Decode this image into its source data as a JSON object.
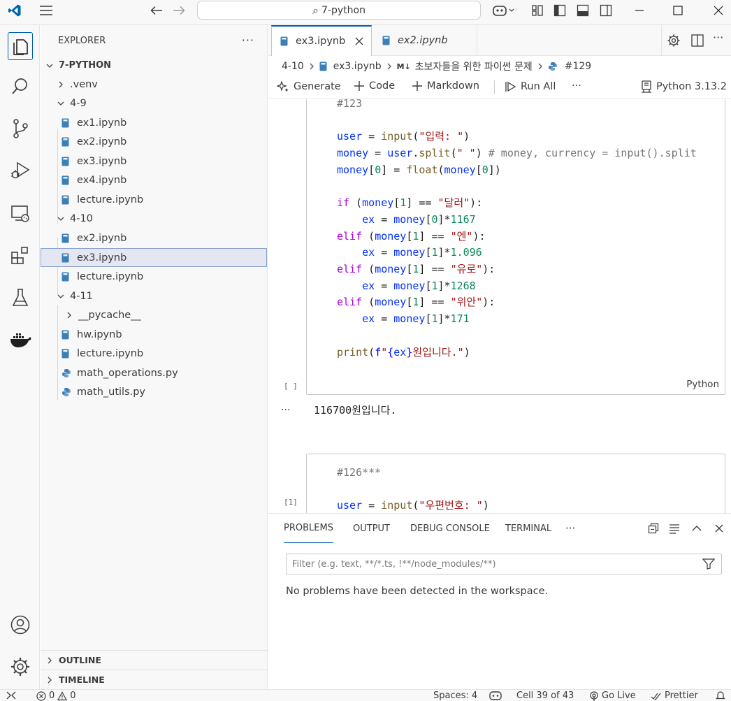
{
  "window": {
    "title": "7-python",
    "search_glyph": "⌕"
  },
  "sidebar": {
    "header": "EXPLORER",
    "more": "···",
    "root": "7-PYTHON",
    "items": [
      {
        "label": ".venv",
        "type": "folder-collapsed"
      },
      {
        "label": "4-9",
        "type": "folder-open"
      },
      {
        "label": "ex1.ipynb",
        "type": "notebook"
      },
      {
        "label": "ex2.ipynb",
        "type": "notebook"
      },
      {
        "label": "ex3.ipynb",
        "type": "notebook"
      },
      {
        "label": "ex4.ipynb",
        "type": "notebook"
      },
      {
        "label": "lecture.ipynb",
        "type": "notebook"
      },
      {
        "label": "4-10",
        "type": "folder-open"
      },
      {
        "label": "ex2.ipynb",
        "type": "notebook"
      },
      {
        "label": "ex3.ipynb",
        "type": "notebook",
        "selected": true
      },
      {
        "label": "lecture.ipynb",
        "type": "notebook"
      },
      {
        "label": "4-11",
        "type": "folder-open"
      },
      {
        "label": "__pycache__",
        "type": "folder-collapsed"
      },
      {
        "label": "hw.ipynb",
        "type": "notebook"
      },
      {
        "label": "lecture.ipynb",
        "type": "notebook"
      },
      {
        "label": "math_operations.py",
        "type": "python"
      },
      {
        "label": "math_utils.py",
        "type": "python"
      }
    ],
    "outline": "OUTLINE",
    "timeline": "TIMELINE"
  },
  "tabs": [
    {
      "label": "ex3.ipynb",
      "active": true
    },
    {
      "label": "ex2.ipynb",
      "active": false
    }
  ],
  "breadcrumbs": {
    "folder": "4-10",
    "file": "ex3.ipynb",
    "md_badge": "M↓",
    "heading": "초보자들을 위한 파이썬 문제",
    "cell": "#129"
  },
  "toolbar": {
    "generate": "Generate",
    "code": "Code",
    "markdown": "Markdown",
    "run_all": "Run All",
    "more": "···",
    "kernel": "Python 3.13.2"
  },
  "cells": {
    "cell1": {
      "exec_count": "[ ]",
      "language": "Python",
      "output_ellipsis": "···",
      "output": "116700원입니다."
    },
    "cell2": {
      "exec_count": "[1]"
    }
  },
  "panel": {
    "tabs": [
      "PROBLEMS",
      "OUTPUT",
      "DEBUG CONSOLE",
      "TERMINAL"
    ],
    "more": "···",
    "filter_placeholder": "Filter (e.g. text, **/*.ts, !**/node_modules/**)",
    "message": "No problems have been detected in the workspace."
  },
  "status": {
    "errors": "0",
    "warnings": "0",
    "spaces": "Spaces: 4",
    "cell": "Cell 39 of 43",
    "go_live": "Go Live",
    "prettier": "Prettier"
  },
  "colors": {
    "accent": "#005fb8",
    "keyword": "#af00db",
    "function": "#795e26",
    "string": "#a31515",
    "number": "#098658",
    "comment": "#008000"
  }
}
